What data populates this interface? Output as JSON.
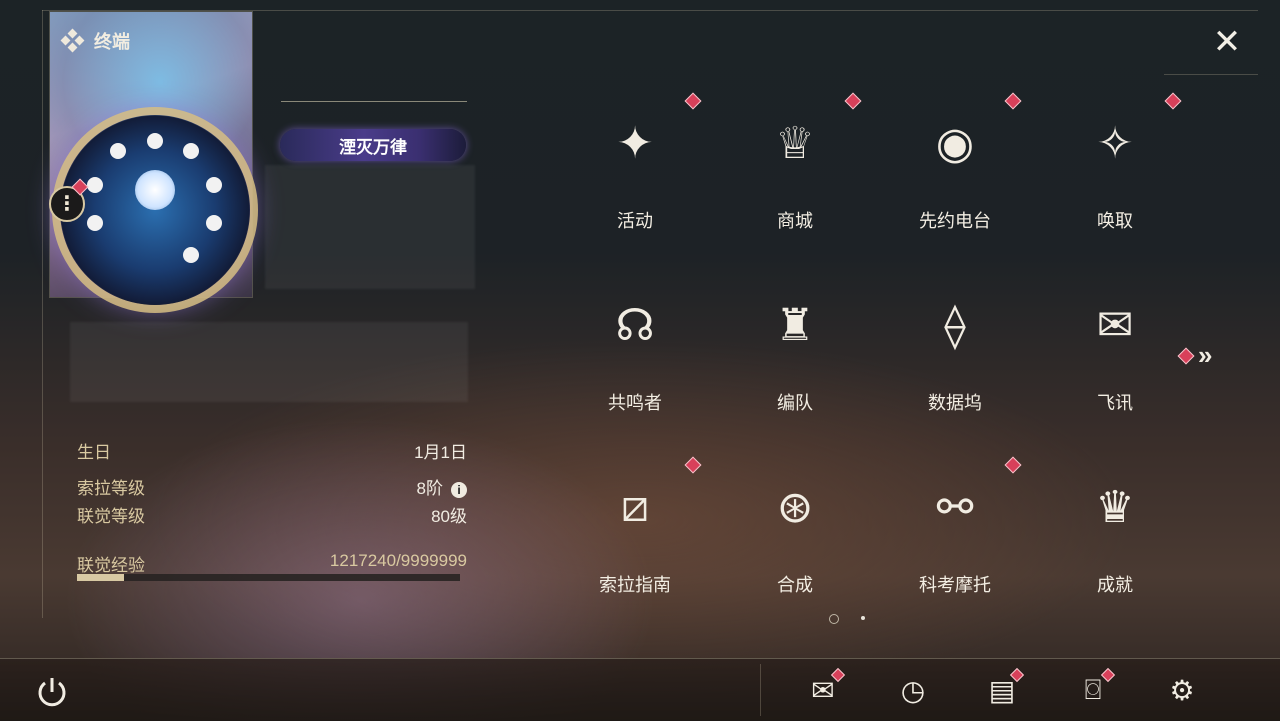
{
  "header": {
    "title": "终端"
  },
  "profile": {
    "honor_title": "湮灭万律",
    "stats": {
      "birthday_label": "生日",
      "birthday_value": "1月1日",
      "sola_level_label": "索拉等级",
      "sola_level_value": "8阶",
      "union_level_label": "联觉等级",
      "union_level_value": "80级",
      "union_exp_label": "联觉经验",
      "union_exp_value": "1217240/9999999",
      "union_exp_fraction": 0.1217
    }
  },
  "menu": {
    "items": [
      {
        "label": "活动",
        "icon": "event-icon",
        "badge": true
      },
      {
        "label": "商城",
        "icon": "shop-cart-icon",
        "badge": true
      },
      {
        "label": "先约电台",
        "icon": "radio-icon",
        "badge": true
      },
      {
        "label": "唤取",
        "icon": "convene-icon",
        "badge": true
      },
      {
        "label": "共鸣者",
        "icon": "resonator-icon",
        "badge": false
      },
      {
        "label": "编队",
        "icon": "team-chess-icon",
        "badge": false
      },
      {
        "label": "数据坞",
        "icon": "data-bank-icon",
        "badge": false
      },
      {
        "label": "飞讯",
        "icon": "message-icon",
        "badge": false
      },
      {
        "label": "索拉指南",
        "icon": "guidebook-icon",
        "badge": true
      },
      {
        "label": "合成",
        "icon": "synthesis-icon",
        "badge": false
      },
      {
        "label": "科考摩托",
        "icon": "motorcycle-icon",
        "badge": true
      },
      {
        "label": "成就",
        "icon": "trophy-icon",
        "badge": false
      }
    ],
    "page_current": 1,
    "page_total": 2
  },
  "bottom_bar": {
    "icons": [
      "power-icon",
      "mail-icon",
      "clock-icon",
      "notice-icon",
      "camera-icon",
      "settings-gear-icon"
    ]
  },
  "colors": {
    "accent_gold": "#d8c9a3",
    "badge_red": "#d8405a",
    "honor_purple": "#4a3c8a"
  }
}
